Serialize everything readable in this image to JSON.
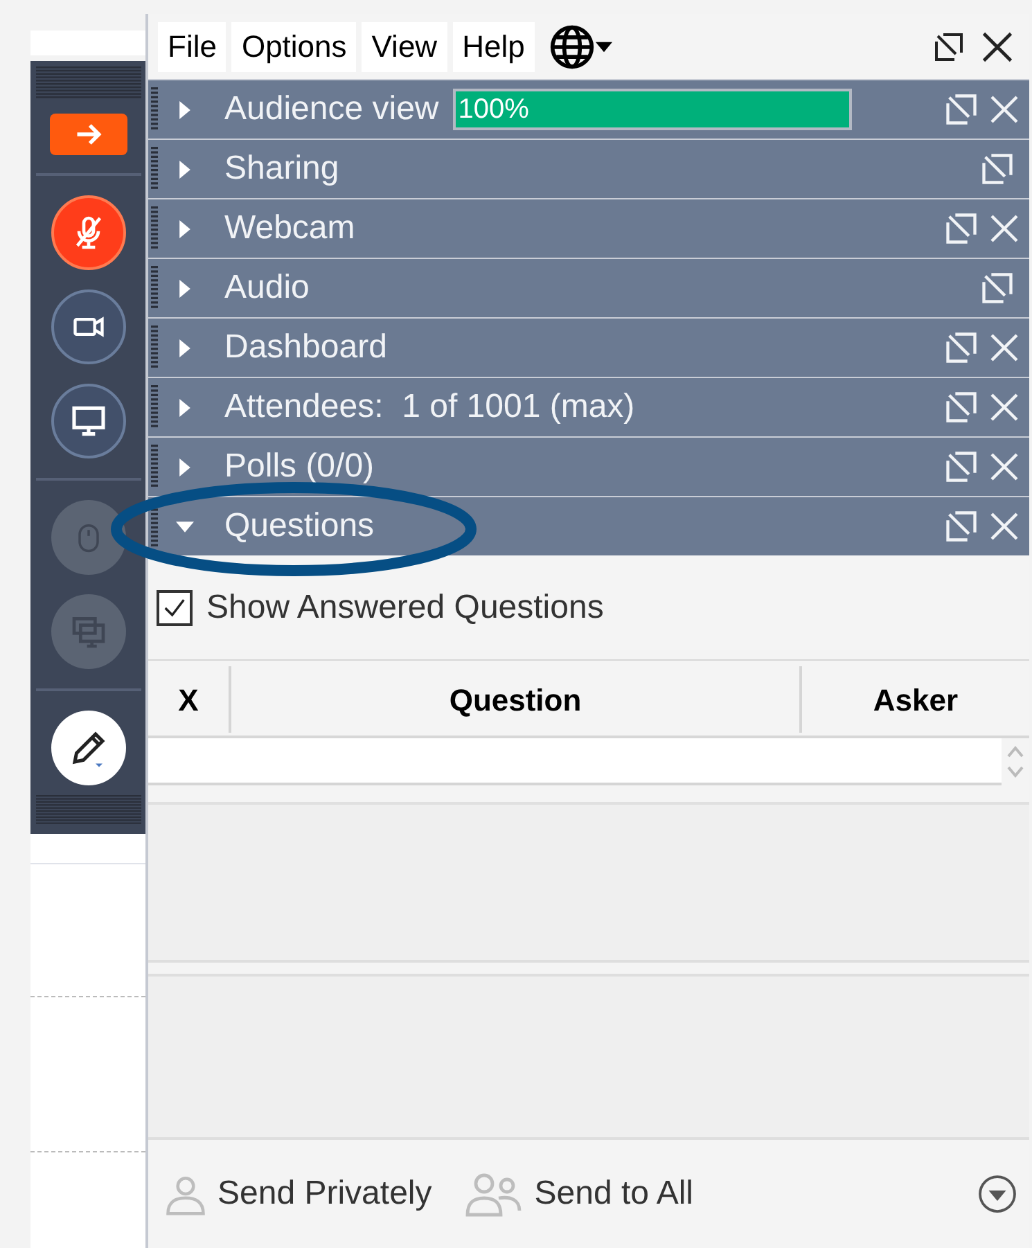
{
  "menu": [
    "File",
    "Options",
    "View",
    "Help"
  ],
  "tools": [
    {
      "kind": "arrow",
      "disabled": false
    },
    {
      "kind": "mic-muted",
      "disabled": false
    },
    {
      "kind": "camera",
      "disabled": false
    },
    {
      "kind": "screen",
      "disabled": false
    },
    {
      "kind": "mouse",
      "disabled": true
    },
    {
      "kind": "screens",
      "disabled": true
    },
    {
      "kind": "pencil",
      "disabled": false
    }
  ],
  "sections": [
    {
      "label": "Audience view",
      "expanded": false,
      "closable": true,
      "meter": {
        "level": 1,
        "reading": "100%"
      }
    },
    {
      "label": "Sharing",
      "expanded": false,
      "closable": false
    },
    {
      "label": "Webcam",
      "expanded": false,
      "closable": true
    },
    {
      "label": "Audio",
      "expanded": false,
      "closable": false
    },
    {
      "label": "Dashboard",
      "expanded": false,
      "closable": true
    },
    {
      "label": "Attendees:  1 of 1001 (max)",
      "expanded": false,
      "closable": true
    },
    {
      "label": "Polls (0/0)",
      "expanded": false,
      "closable": true
    },
    {
      "label": "Questions",
      "expanded": true,
      "closable": true,
      "highlighted": true
    }
  ],
  "questions": {
    "show_answered": {
      "label": "Show Answered Questions",
      "checked": true
    },
    "columns": [
      "X",
      "Question",
      "Asker"
    ],
    "send_privately": "Send Privately",
    "send_to_all": "Send to All"
  }
}
